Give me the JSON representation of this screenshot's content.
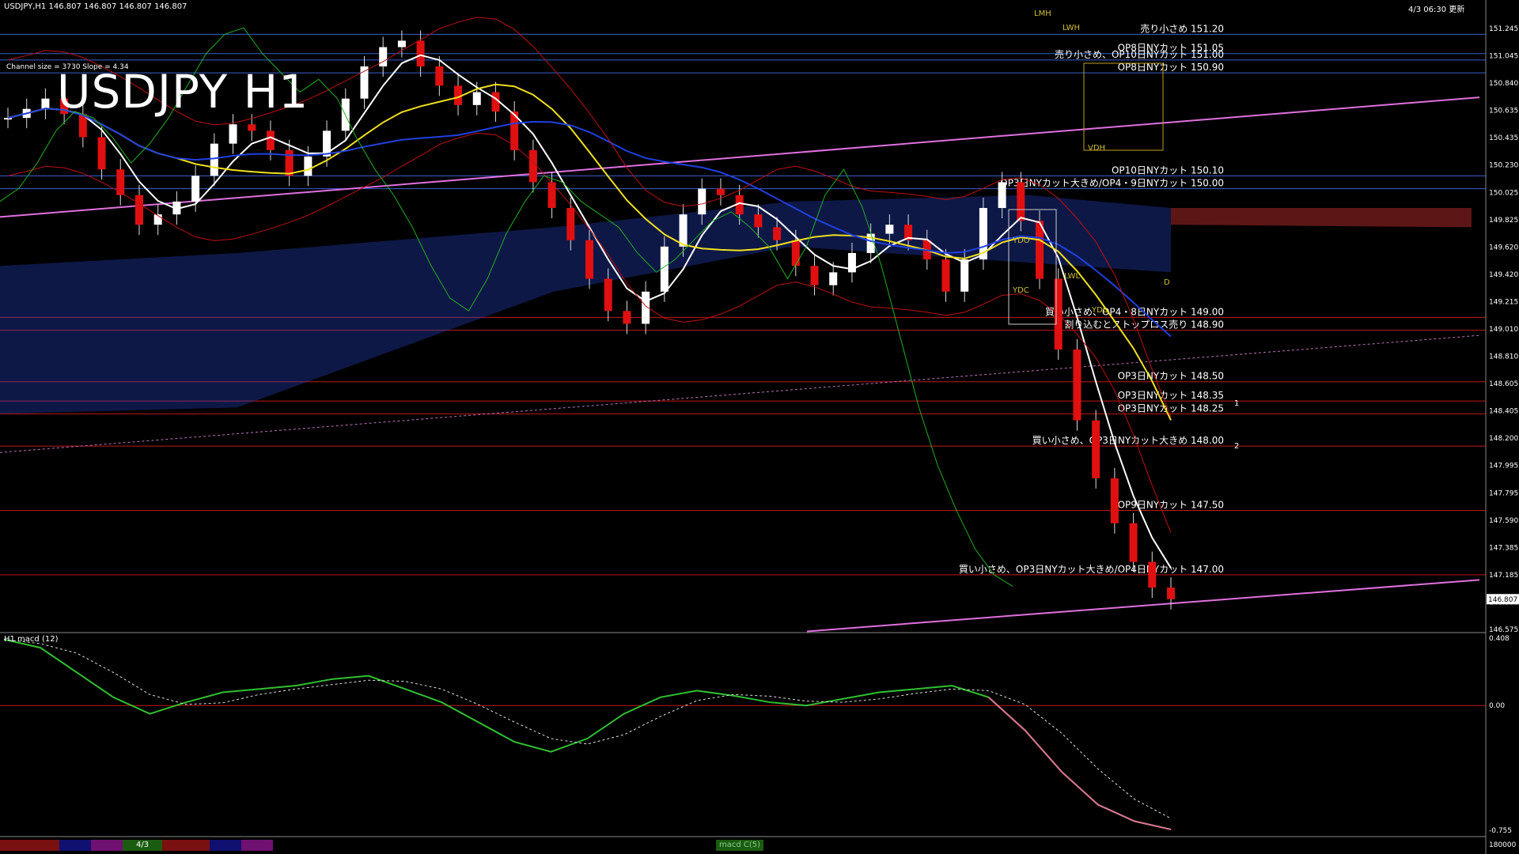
{
  "header": {
    "symbol_info": "USDJPY,H1  146.807 146.807 146.807 146.807",
    "updated": "4/3 06:30 更新",
    "title": "USDJPY H1",
    "channel_info": "Channel size = 3730 Slope = 4.34"
  },
  "indicator": {
    "label": "H1  macd (12)",
    "levels": [
      "0.408",
      "0.00",
      "-0.755"
    ]
  },
  "price_scale": [
    "151.245",
    "151.045",
    "150.840",
    "150.635",
    "150.435",
    "150.230",
    "150.025",
    "149.825",
    "149.620",
    "149.420",
    "149.215",
    "149.010",
    "148.810",
    "148.605",
    "148.405",
    "148.200",
    "147.995",
    "147.795",
    "147.590",
    "147.385",
    "147.185",
    "146.980",
    "146.575"
  ],
  "current_price": "146.807",
  "macd_scale_bottom": "180000",
  "order_labels": [
    {
      "text": "売り小さめ 151.20",
      "price": 151.2
    },
    {
      "text": "OP8日NYカット 151.05",
      "price": 151.05
    },
    {
      "text": "売り小さめ、OP10日NYカット 151.00",
      "price": 151.0
    },
    {
      "text": "OP8日NYカット 150.90",
      "price": 150.9
    },
    {
      "text": "OP10日NYカット 150.10",
      "price": 150.1
    },
    {
      "text": "OP3日NYカット大きめ/OP4・9日NYカット 150.00",
      "price": 150.0
    },
    {
      "text": "買い小さめ、OP4・8日NYカット 149.00",
      "price": 149.0
    },
    {
      "text": "割り込むとストップロス売り 148.90",
      "price": 148.9
    },
    {
      "text": "OP3日NYカット 148.50",
      "price": 148.5
    },
    {
      "text": "OP3日NYカット 148.35",
      "price": 148.35
    },
    {
      "text": "OP3日NYカット 148.25",
      "price": 148.25
    },
    {
      "text": "買い小さめ、OP3日NYカット大きめ 148.00",
      "price": 148.0
    },
    {
      "text": "OP9日NYカット 147.50",
      "price": 147.5
    },
    {
      "text": "買い小さめ、OP3日NYカット大きめ/OP4日NYカット 147.00",
      "price": 147.0
    }
  ],
  "box_labels": [
    "LMH",
    "LWH",
    "VDH",
    "LWL",
    "YDO",
    "YDC",
    "YDL",
    "D",
    "1",
    "2"
  ],
  "toolbar": {
    "date_tab": "4/3",
    "macd_tab": "macd C(5)"
  },
  "chart_data": {
    "type": "line",
    "title": "USDJPY H1",
    "series": [
      {
        "name": "USDJPY close",
        "values": [
          150.55,
          150.62,
          150.7,
          150.58,
          150.4,
          150.15,
          149.95,
          149.72,
          149.8,
          149.9,
          150.1,
          150.35,
          150.5,
          150.45,
          150.3,
          150.1,
          150.25,
          150.45,
          150.7,
          150.95,
          151.1,
          151.15,
          150.95,
          150.8,
          150.65,
          150.75,
          150.6,
          150.3,
          150.05,
          149.85,
          149.6,
          149.3,
          149.05,
          148.95,
          149.2,
          149.55,
          149.8,
          150.0,
          149.95,
          149.8,
          149.7,
          149.6,
          149.4,
          149.25,
          149.35,
          149.5,
          149.65,
          149.72,
          149.6,
          149.45,
          149.2,
          149.45,
          149.85,
          150.05,
          149.75,
          149.3,
          148.75,
          148.2,
          147.75,
          147.4,
          147.1,
          146.9,
          146.81
        ]
      },
      {
        "name": "MACD",
        "values": [
          0.4,
          0.35,
          0.2,
          0.05,
          -0.05,
          0.02,
          0.08,
          0.1,
          0.12,
          0.16,
          0.18,
          0.1,
          0.02,
          -0.1,
          -0.22,
          -0.28,
          -0.2,
          -0.05,
          0.05,
          0.09,
          0.06,
          0.02,
          0.0,
          0.04,
          0.08,
          0.1,
          0.12,
          0.05,
          -0.15,
          -0.4,
          -0.6,
          -0.7,
          -0.75
        ]
      }
    ],
    "ylim": [
      146.5,
      151.3
    ]
  }
}
